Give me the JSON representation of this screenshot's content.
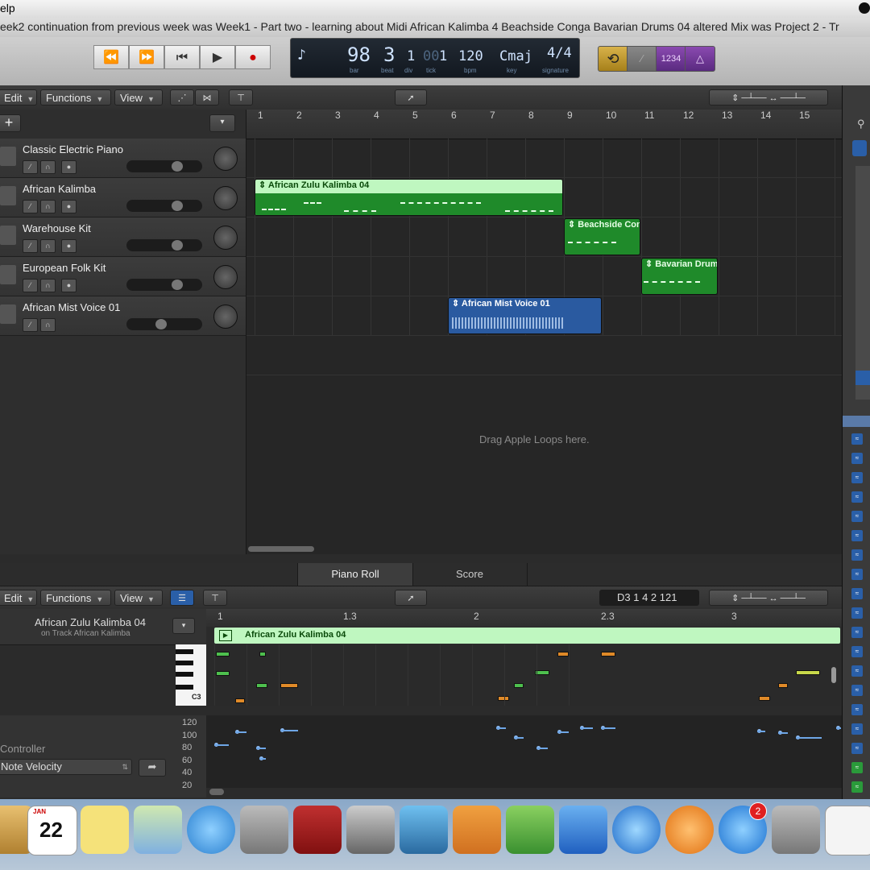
{
  "menubar": {
    "text": "elp"
  },
  "window": {
    "title": "eek2 continuation from previous week was Week1 - Part two - learning about Midi African Kalimba 4 Beachside Conga Bavarian Drums 04 altered Mix was Project 2 - Tr"
  },
  "transport": {
    "rewind": "⏪",
    "forward": "⏩",
    "to_start": "⏮",
    "play": "▶",
    "record": "●"
  },
  "lcd": {
    "bar": "98",
    "beat": "3",
    "div": "1",
    "tick": "1",
    "tick_faint": "00",
    "bpm": "120",
    "key": "Cmaj",
    "signature": "4/4",
    "labels": {
      "bar": "bar",
      "beat": "beat",
      "div": "div",
      "tick": "tick",
      "bpm": "bpm",
      "key": "key",
      "signature": "signature"
    }
  },
  "lcd_right": {
    "count_in": "1234"
  },
  "tracks_header": {
    "edit": "Edit",
    "functions": "Functions",
    "view": "View"
  },
  "tracks": [
    {
      "name": "Classic Electric Piano",
      "record": true
    },
    {
      "name": "African Kalimba",
      "record": true
    },
    {
      "name": "Warehouse Kit",
      "record": true
    },
    {
      "name": "European Folk Kit",
      "record": true
    },
    {
      "name": "African Mist Voice 01",
      "record": false
    }
  ],
  "ruler": [
    "1",
    "2",
    "3",
    "4",
    "5",
    "6",
    "7",
    "8",
    "9",
    "10",
    "11",
    "12",
    "13",
    "14",
    "15"
  ],
  "regions": [
    {
      "label": "African Zulu Kalimba 04",
      "track": 1,
      "color": "#bff7c0",
      "text": "#0a4a0a"
    },
    {
      "label": "Beachside Con",
      "track": 2,
      "color": "#1f8a2a",
      "text": "#e8ffe8"
    },
    {
      "label": "Bavarian Drum",
      "track": 3,
      "color": "#1f8a2a",
      "text": "#e8ffe8"
    },
    {
      "label": "African Mist Voice 01",
      "track": 4,
      "color": "#2a5aa0",
      "text": "#ffffff"
    }
  ],
  "drop_hint": "Drag Apple Loops here.",
  "editor_tabs": {
    "piano_roll": "Piano Roll",
    "score": "Score"
  },
  "editor": {
    "edit": "Edit",
    "functions": "Functions",
    "view": "View",
    "position": "D3   1 4 2 121",
    "region_name": "African Zulu Kalimba 04",
    "region_track": "on Track African Kalimba",
    "ruler": [
      "1",
      "1.3",
      "2",
      "2.3",
      "3"
    ],
    "region_label": "African Zulu Kalimba 04",
    "key_label": "C3",
    "controller_label": "Controller",
    "controller_value": "Note Velocity",
    "vel_axis": [
      "120",
      "100",
      "80",
      "60",
      "40",
      "20"
    ]
  },
  "dock": {
    "calendar_month": "JAN",
    "calendar_day": "22",
    "appstore_badge": "2"
  }
}
